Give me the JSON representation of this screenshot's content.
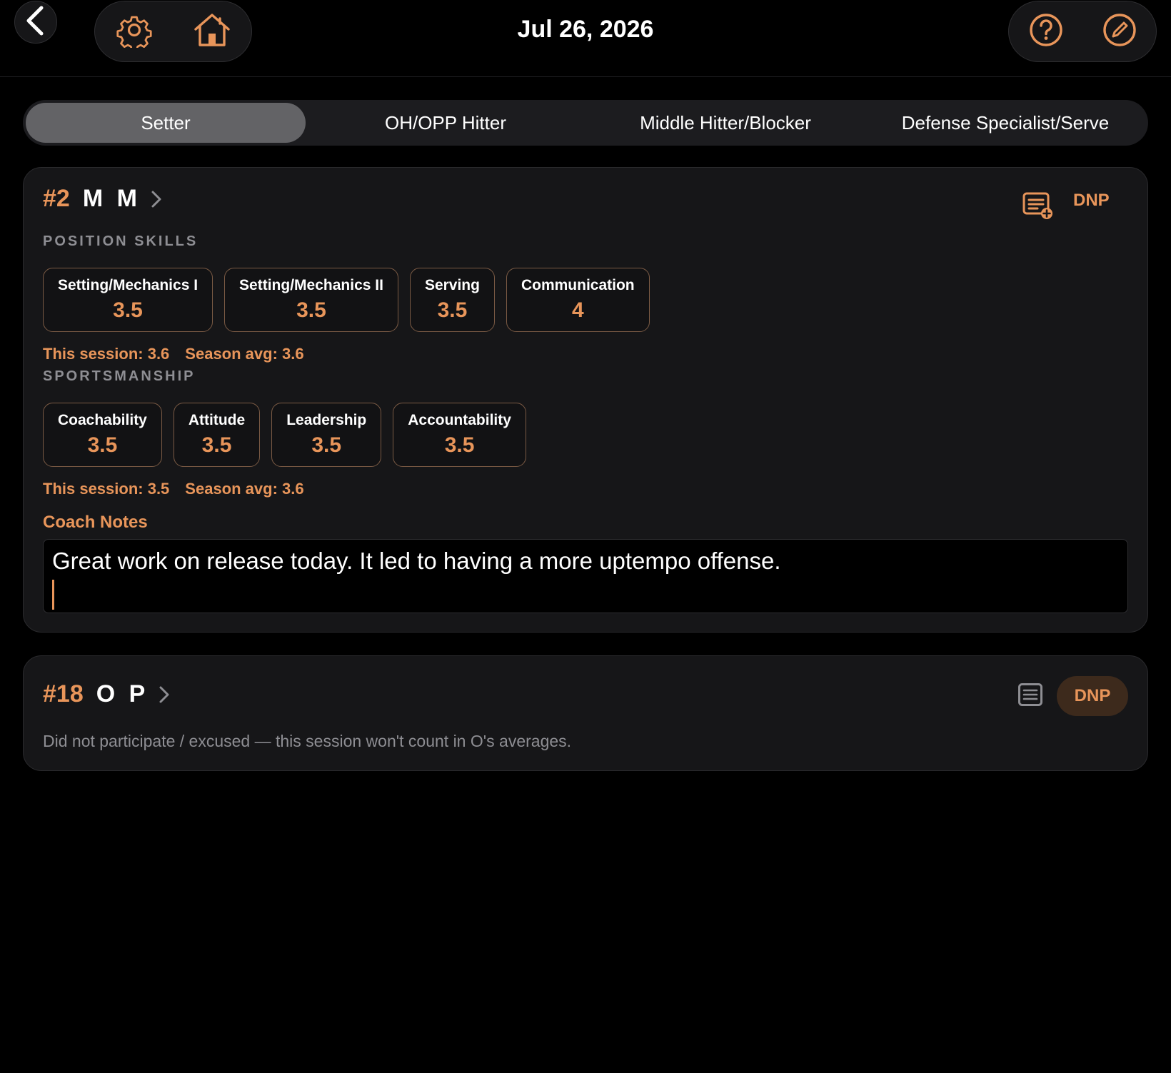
{
  "header": {
    "title": "Jul 26, 2026",
    "back_icon": "chevron-left-icon",
    "settings_icon": "gear-icon",
    "home_icon": "home-icon",
    "help_icon": "question-circle-icon",
    "edit_icon": "pencil-circle-icon"
  },
  "colors": {
    "accent": "#e8955a",
    "background": "#000000",
    "card": "#161618",
    "muted": "#8e8e93"
  },
  "tabs": [
    {
      "label": "Setter",
      "active": true
    },
    {
      "label": "OH/OPP Hitter",
      "active": false
    },
    {
      "label": "Middle Hitter/Blocker",
      "active": false
    },
    {
      "label": "Defense Specialist/Serve",
      "active": false
    }
  ],
  "players": [
    {
      "number": "#2",
      "name": "M M",
      "dnp_label": "DNP",
      "notes_icon": "note-add-icon",
      "position_skills": {
        "label": "POSITION SKILLS",
        "items": [
          {
            "label": "Setting/Mechanics I",
            "value": "3.5"
          },
          {
            "label": "Setting/Mechanics II",
            "value": "3.5"
          },
          {
            "label": "Serving",
            "value": "3.5"
          },
          {
            "label": "Communication",
            "value": "4"
          }
        ],
        "session": "This session: 3.6",
        "season": "Season avg: 3.6"
      },
      "sportsmanship": {
        "label": "SPORTSMANSHIP",
        "items": [
          {
            "label": "Coachability",
            "value": "3.5"
          },
          {
            "label": "Attitude",
            "value": "3.5"
          },
          {
            "label": "Leadership",
            "value": "3.5"
          },
          {
            "label": "Accountability",
            "value": "3.5"
          }
        ],
        "session": "This session: 3.5",
        "season": "Season avg: 3.6"
      },
      "coach_notes_label": "Coach Notes",
      "coach_notes": "Great work on release today. It led to having a more uptempo offense."
    },
    {
      "number": "#18",
      "name": "O P",
      "dnp_label": "DNP",
      "notes_icon": "note-icon",
      "dnp_message": "Did not participate / excused — this session won't count in O's averages."
    }
  ]
}
